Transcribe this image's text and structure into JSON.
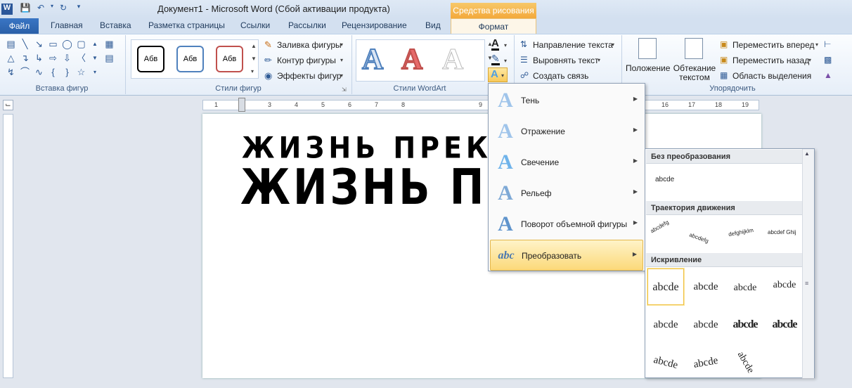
{
  "window": {
    "title": "Документ1 - Microsoft Word (Сбой активации продукта)"
  },
  "context_tab_group": "Средства рисования",
  "tabs": [
    {
      "label": "Файл"
    },
    {
      "label": "Главная"
    },
    {
      "label": "Вставка"
    },
    {
      "label": "Разметка страницы"
    },
    {
      "label": "Ссылки"
    },
    {
      "label": "Рассылки"
    },
    {
      "label": "Рецензирование"
    },
    {
      "label": "Вид"
    },
    {
      "label": "Формат"
    }
  ],
  "ribbon": {
    "groups": {
      "insert_shapes": "Вставка фигур",
      "shape_styles": "Стили фигур",
      "wordart_styles": "Стили WordArt",
      "arrange": "Упорядочить"
    },
    "shape_style_samples": [
      "Абв",
      "Абв",
      "Абв"
    ],
    "shape_commands": [
      "Заливка фигуры",
      "Контур фигуры",
      "Эффекты фигур"
    ],
    "wordart_letter": "A",
    "text_commands": [
      "Направление текста",
      "Выровнять текст",
      "Создать связь"
    ],
    "arrange_big": {
      "position": [
        "Положение"
      ],
      "wrap": [
        "Обтекание",
        "текстом"
      ]
    },
    "arrange_commands": [
      "Переместить вперед",
      "Переместить назад",
      "Область выделения"
    ]
  },
  "ruler_numbers": [
    "1",
    "2",
    "3",
    "4",
    "5",
    "6",
    "7",
    "8",
    "9",
    "16",
    "17",
    "18",
    "19"
  ],
  "document": {
    "line1": "ЖИЗНЬ ПРЕКРА",
    "line2": "ЖИЗНЬ ПРЕКРА"
  },
  "effects_menu": {
    "items": [
      {
        "label": "Тень",
        "icon": "shadow-icon"
      },
      {
        "label": "Отражение",
        "icon": "reflection-icon"
      },
      {
        "label": "Свечение",
        "icon": "glow-icon"
      },
      {
        "label": "Рельеф",
        "icon": "bevel-icon"
      },
      {
        "label": "Поворот объемной фигуры",
        "icon": "3d-rotation-icon"
      },
      {
        "label": "Преобразовать",
        "icon": "transform-icon"
      }
    ],
    "active_index": 5
  },
  "transform_submenu": {
    "sections": [
      {
        "header": "Без преобразования",
        "samples": [
          "abcde"
        ]
      },
      {
        "header": "Траектория движения",
        "samples": [
          "abcdefg",
          "abcdefg",
          "defghijklm",
          "abcdef Ghij"
        ]
      },
      {
        "header": "Искривление",
        "samples": [
          "abcde",
          "abcde",
          "abcde",
          "abcde",
          "abcde",
          "abcde",
          "abcde",
          "abcde",
          "abcde",
          "abcde",
          "abcde",
          "abcde abc abcde"
        ]
      }
    ]
  },
  "colors": {
    "accent": "#2a5fa8",
    "context_tab": "#f3a93b",
    "menu_active": "#fcd97a"
  }
}
